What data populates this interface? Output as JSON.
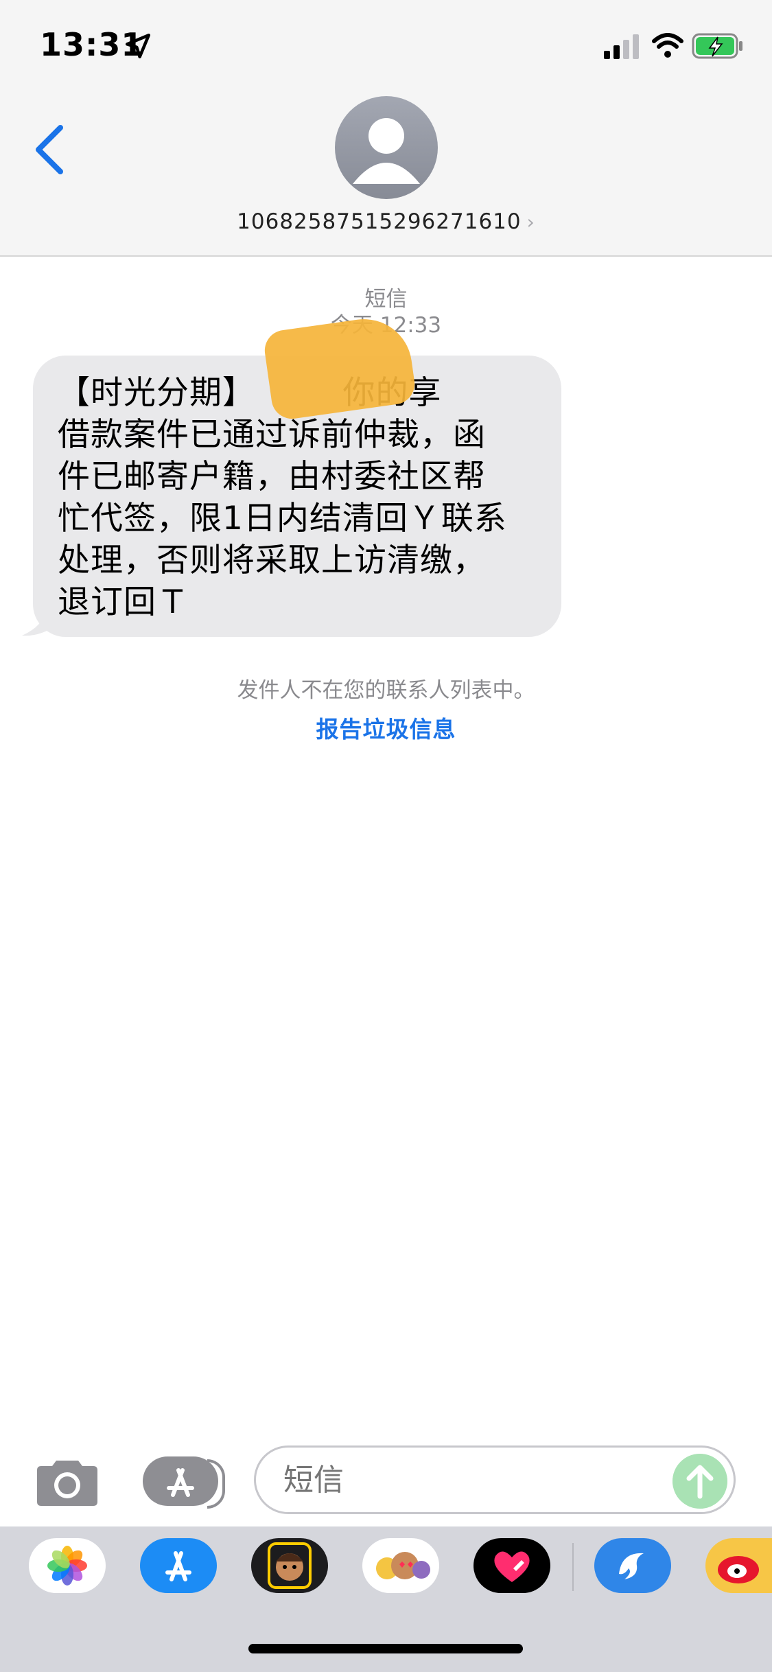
{
  "status_bar": {
    "time": "13:31",
    "icons": [
      "location-arrow-icon",
      "cellular-signal-icon",
      "wifi-icon",
      "battery-charging-icon"
    ]
  },
  "header": {
    "contact_number": "106825875152962716​10",
    "chevron": "›"
  },
  "thread": {
    "service_label": "短信",
    "timestamp": "今天 12:33",
    "message_lines": [
      "【时光分期】        你的享",
      "借款案件已通过诉前仲裁，函",
      "件已邮寄户籍，由村委社区帮",
      "忙代签，限1日内结清回Ｙ联系",
      "处理，否则将采取上访清缴，",
      "退订回Ｔ"
    ],
    "sender_notice": "发件人不在您的联系人列表中。",
    "report_link": "报告垃圾信息"
  },
  "composer": {
    "placeholder": "短信"
  },
  "app_drawer": {
    "apps": [
      "photos-app",
      "app-store-app",
      "memoji-camera-app",
      "memoji-stickers-app",
      "digital-touch-app",
      "dolphin-app",
      "weibo-app"
    ]
  },
  "colors": {
    "accent_blue": "#1a73e8",
    "bubble_gray": "#e9e9eb",
    "send_green": "#a9e2b4",
    "header_bg": "#f5f5f5"
  }
}
